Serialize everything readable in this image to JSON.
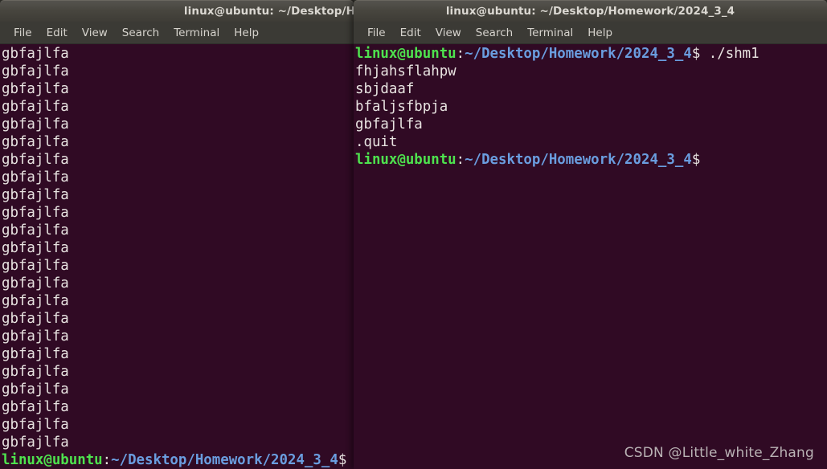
{
  "meta": {
    "colors": {
      "terminal_bg": "#300a24",
      "titlebar_bg": "#48463f",
      "menubar_bg": "#3b3a35",
      "prompt_user": "#4ee24e",
      "prompt_path": "#6a9ddf",
      "text_fg": "#e8e3e1"
    }
  },
  "left_window": {
    "title": "linux@ubuntu: ~/Desktop/H",
    "menu": [
      {
        "label": "File"
      },
      {
        "label": "Edit"
      },
      {
        "label": "View"
      },
      {
        "label": "Search"
      },
      {
        "label": "Terminal"
      },
      {
        "label": "Help"
      }
    ],
    "terminal": {
      "output_line": "gbfajlfa",
      "output_line_count": 23,
      "prompt": {
        "user_host": "linux@ubuntu",
        "separator": ":",
        "path": "~/Desktop/Homework/2024_3_4",
        "sigil": "$",
        "command": ""
      },
      "cursor_visible": true
    }
  },
  "right_window": {
    "title": "linux@ubuntu: ~/Desktop/Homework/2024_3_4",
    "menu": [
      {
        "label": "File"
      },
      {
        "label": "Edit"
      },
      {
        "label": "View"
      },
      {
        "label": "Search"
      },
      {
        "label": "Terminal"
      },
      {
        "label": "Help"
      }
    ],
    "terminal": {
      "prompt": {
        "user_host": "linux@ubuntu",
        "separator": ":",
        "path": "~/Desktop/Homework/2024_3_4",
        "sigil": "$",
        "command": " ./shm1"
      },
      "output": [
        "fhjahsflahpw",
        "sbjdaaf",
        "bfaljsfbpja",
        "gbfajlfa",
        ".quit"
      ],
      "final_prompt": {
        "user_host": "linux@ubuntu",
        "separator": ":",
        "path": "~/Desktop/Homework/2024_3_4",
        "sigil": "$",
        "command": ""
      }
    }
  },
  "watermark": {
    "text": "CSDN @Little_white_Zhang"
  }
}
